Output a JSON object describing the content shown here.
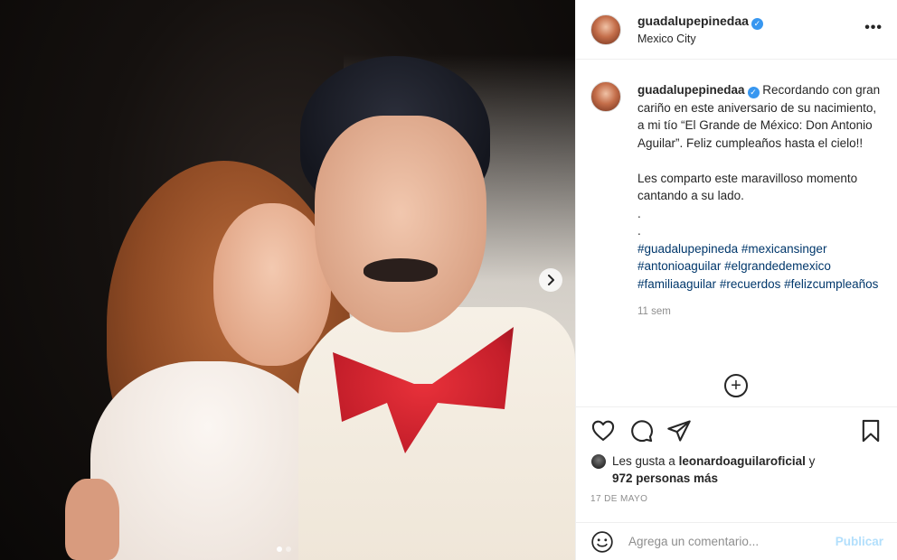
{
  "post": {
    "username": "guadalupepinedaa",
    "location": "Mexico City",
    "verified": true
  },
  "caption": {
    "username": "guadalupepinedaa",
    "line1": "Recordando con gran cariño en este aniversario de su nacimiento, a mi tío “El Grande de México: Don Antonio Aguilar”. Feliz cumpleaños hasta el cielo!!",
    "line2": "Les comparto este maravilloso momento cantando a su lado.",
    "dot1": ".",
    "dot2": ".",
    "hashtags": [
      "#guadalupepineda",
      "#mexicansinger",
      "#antonioaguilar",
      "#elgrandedemexico",
      "#familiaaguilar",
      "#recuerdos",
      "#felizcumpleaños"
    ],
    "time_ago": "11 sem"
  },
  "likes": {
    "prefix": "Les gusta a",
    "user": "leonardoaguilaroficial",
    "joiner": "y",
    "others": "972 personas más"
  },
  "date": "17 DE MAYO",
  "comment_box": {
    "placeholder": "Agrega un comentario...",
    "publish_label": "Publicar"
  },
  "carousel": {
    "total_slides": 2,
    "active_index": 0
  },
  "icons": {
    "more": "more-options-icon",
    "like": "heart-icon",
    "comment": "comment-bubble-icon",
    "share": "paper-plane-icon",
    "save": "bookmark-icon",
    "emoji": "smiley-icon",
    "load_more": "plus-circle-icon",
    "next": "chevron-right-icon"
  },
  "colors": {
    "verified": "#3897f0",
    "hashtag": "#00376b",
    "publish_disabled": "#b2dffc"
  }
}
